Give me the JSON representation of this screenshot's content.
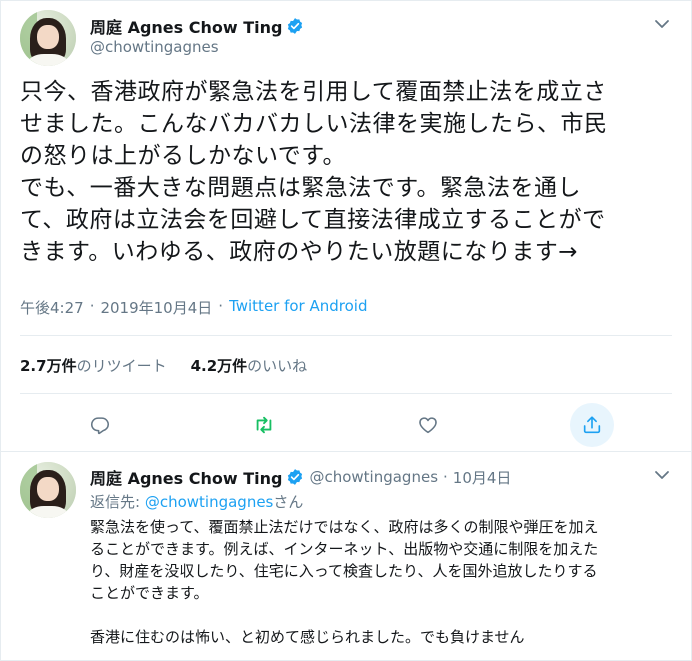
{
  "tweet": {
    "display_name": "周庭 Agnes Chow Ting",
    "handle": "@chowtingagnes",
    "text_lines": [
      "只今、香港政府が緊急法を引用して覆面禁止法を成立さ",
      "せました。こんなバカバカしい法律を実施したら、市民",
      "の怒りは上がるしかないです。",
      "でも、一番大きな問題点は緊急法です。緊急法を通し",
      "て、政府は立法会を回避して直接法律成立することがで",
      "きます。いわゆる、政府のやりたい放題になります→"
    ],
    "time": "午後4:27",
    "dot": "·",
    "date": "2019年10月4日",
    "source": "Twitter for Android",
    "retweet_count": "2.7万件",
    "retweet_label": "のリツイート",
    "like_count": "4.2万件",
    "like_label": "のいいね"
  },
  "reply": {
    "display_name": "周庭 Agnes Chow Ting",
    "handle": "@chowtingagnes",
    "dot": "·",
    "date": "10月4日",
    "reply_to_prefix": "返信先: ",
    "reply_to_handle": "@chowtingagnes",
    "reply_to_suffix": "さん",
    "text_lines": [
      "緊急法を使って、覆面禁止法だけではなく、政府は多くの制限や弾圧を加え",
      "ることができます。例えば、インターネット、出版物や交通に制限を加えた",
      "り、財産を没収したり、住宅に入って検査したり、人を国外追放したりする",
      "ことができます。",
      "",
      "香港に住むのは怖い、と初めて感じられました。でも負けません"
    ]
  },
  "icons": {
    "verified": "verified-badge-icon",
    "chevron": "chevron-down-icon",
    "reply": "reply-icon",
    "retweet": "retweet-icon",
    "like": "heart-icon",
    "share": "share-icon"
  },
  "colors": {
    "accent": "#1da1f2",
    "retweet_active": "#17bf63",
    "muted": "#657786",
    "text": "#14171a"
  }
}
